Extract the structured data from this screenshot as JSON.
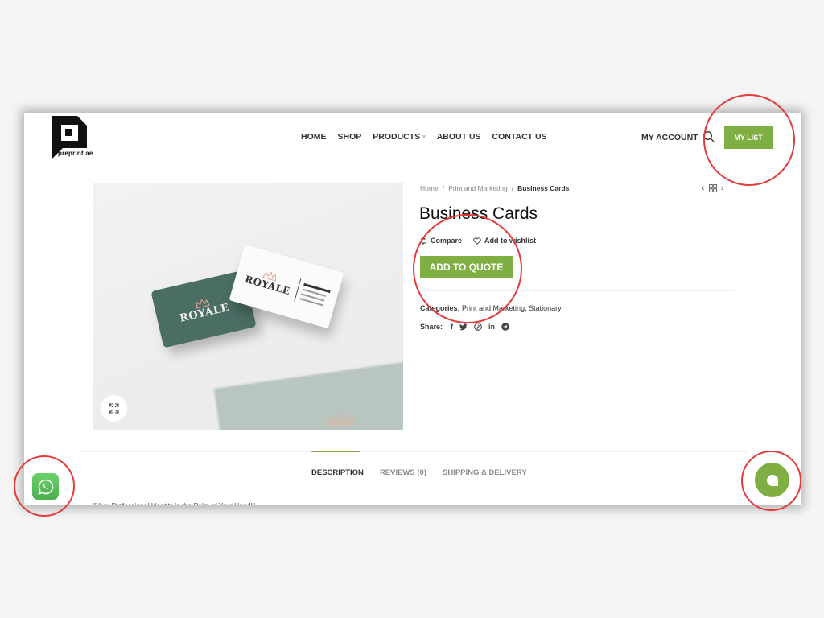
{
  "brand": {
    "logo_text": "preprint.ae",
    "accent_color": "#7fae42"
  },
  "nav": {
    "items": [
      {
        "label": "HOME"
      },
      {
        "label": "SHOP"
      },
      {
        "label": "PRODUCTS",
        "has_dropdown": true
      },
      {
        "label": "ABOUT US"
      },
      {
        "label": "CONTACT US"
      }
    ],
    "my_account": "MY ACCOUNT",
    "my_list": "MY LIST",
    "search_icon": "search-icon"
  },
  "breadcrumb": {
    "items": [
      "Home",
      "Print and Marketing"
    ],
    "separator": "/",
    "current": "Business Cards"
  },
  "product": {
    "title": "Business Cards",
    "compare_label": "Compare",
    "wishlist_label": "Add to wishlist",
    "add_to_quote_label": "ADD TO QUOTE",
    "categories_label": "Categories:",
    "categories": [
      "Print and Marketing",
      "Stationary"
    ],
    "share_label": "Share:",
    "share_icons": [
      "f",
      "t",
      "p",
      "in",
      "tg"
    ],
    "image": {
      "card_brand": "ROYALE",
      "zoom_icon": "expand-icon"
    }
  },
  "tabs": {
    "items": [
      {
        "label": "DESCRIPTION",
        "active": true
      },
      {
        "label": "REVIEWS (0)",
        "active": false
      },
      {
        "label": "SHIPPING & DELIVERY",
        "active": false
      }
    ],
    "description_preview": "\"Your Professional Identity in the Palm of Your Hand!\""
  },
  "floating": {
    "whatsapp_icon": "whatsapp-icon",
    "chat_icon": "chat-bubble-icon"
  },
  "annotations": {
    "color": "#e53a3a"
  }
}
